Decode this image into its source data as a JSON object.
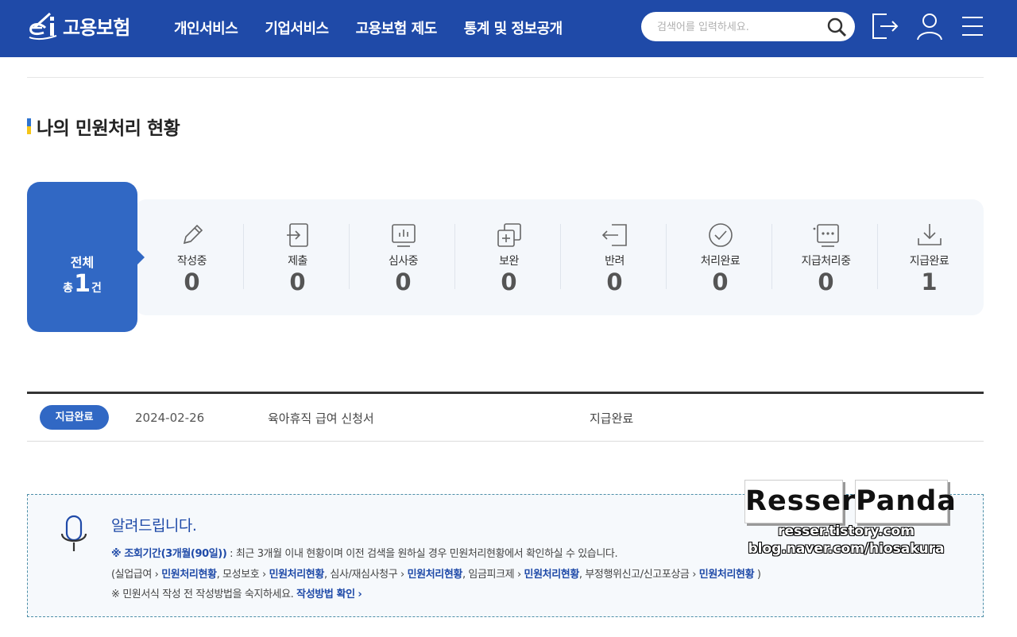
{
  "header": {
    "logo_text": "고용보험",
    "nav": [
      "개인서비스",
      "기업서비스",
      "고용보험 제도",
      "통계 및 정보공개"
    ],
    "search_placeholder": "검색어를 입력하세요.",
    "icons": [
      "logout-icon",
      "user-icon",
      "menu-icon"
    ]
  },
  "section": {
    "title": "나의 민원처리 현황"
  },
  "summary": {
    "total_label": "전체",
    "total_prefix": "총",
    "total_count": "1",
    "total_suffix": "건",
    "statuses": [
      {
        "label": "작성중",
        "count": "0",
        "icon": "pencil-icon"
      },
      {
        "label": "제출",
        "count": "0",
        "icon": "submit-icon"
      },
      {
        "label": "심사중",
        "count": "0",
        "icon": "review-icon"
      },
      {
        "label": "보완",
        "count": "0",
        "icon": "supplement-icon"
      },
      {
        "label": "반려",
        "count": "0",
        "icon": "return-icon"
      },
      {
        "label": "처리완료",
        "count": "0",
        "icon": "check-circle-icon"
      },
      {
        "label": "지급처리중",
        "count": "0",
        "icon": "payment-processing-icon"
      },
      {
        "label": "지급완료",
        "count": "1",
        "icon": "download-icon"
      }
    ]
  },
  "list": [
    {
      "badge": "지급완료",
      "date": "2024-02-26",
      "title": "육아휴직 급여 신청서",
      "status": "지급완료"
    }
  ],
  "notice": {
    "title": "알려드립니다.",
    "period_label": "※ 조회기간(3개월(90일))",
    "period_text": " : 최근 3개월 이내 현황이며 이전 검색을 원하실 경우 민원처리현황에서 확인하실 수 있습니다.",
    "open_paren": "(실업급여 ",
    "link_text": "민원처리현황",
    "items": [
      ", 모성보호 ",
      ", 심사/재심사청구 ",
      ", 임금피크제 ",
      ", 부정행위신고/신고포상금 "
    ],
    "close_paren": " )",
    "method_text": "※ 민원서식 작성 전 작성방법을 숙지하세요. ",
    "method_link": "작성방법 확인",
    "chevron": "›"
  },
  "watermark": {
    "word1": "Resser",
    "word2": "Panda",
    "url1": "resser.tistory.com",
    "url2": "blog.naver.com/hiosakura"
  },
  "colors": {
    "header_bg": "#1f4aa8",
    "accent": "#3168c4",
    "title_bar_top": "#2f74d0",
    "title_bar_bottom": "#f5c518"
  }
}
